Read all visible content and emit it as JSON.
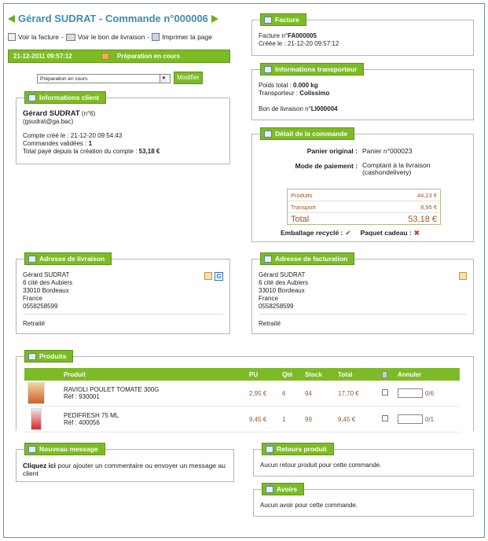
{
  "header": {
    "title": "Gérard SUDRAT - Commande n°000006",
    "links": [
      "Voir la facture",
      "Voir le bon de livraison",
      "Imprimer la page"
    ],
    "separator": "-"
  },
  "status": {
    "date": "21-12-2011 09:57:12",
    "label": "Préparation en cours",
    "select_value": "Préparation en cours",
    "button": "Modifier"
  },
  "client": {
    "title": "Informations client",
    "name": "Gérard SUDRAT",
    "num": "(n°6)",
    "email": "(gsudrat@ga.bac)",
    "created": "Compte créé le : 21-12-20   09:54:43",
    "validated_label": "Commandes validées :",
    "validated_value": "1",
    "total_label": "Total payé depuis la création du compte :",
    "total_value": "53,18 €"
  },
  "facture": {
    "title": "Facture",
    "num_label": "Facture n°",
    "num_value": "FA000005",
    "created": "Créée le : 21-12-20   09:57:12"
  },
  "transport": {
    "title": "Informations transporteur",
    "weight_label": "Poids total :",
    "weight_value": "0.000 kg",
    "carrier_label": "Transporteur :",
    "carrier_value": "Colissimo",
    "delivery_label": "Bon de livraison n°",
    "delivery_value": "LI000004"
  },
  "detail": {
    "title": "Détail de la commande",
    "cart_label": "Panier original :",
    "cart_value": "Panier n°000023",
    "payment_label": "Mode de paiement :",
    "payment_value_1": "Comptant à la livraison",
    "payment_value_2": "(cashondelivery)",
    "products_label": "Produits",
    "products_value": "44,23 €",
    "transport_label": "Transport",
    "transport_value": "8,95 €",
    "total_label": "Total",
    "total_value": "53,18 €",
    "recycled_label": "Emballage recyclé :",
    "gift_label": "Paquet cadeau :"
  },
  "delivery_address": {
    "title": "Adresse de livraison",
    "lines": [
      "Gérard SUDRAT",
      "6 cité des Aubiers",
      "33010 Bordeaux",
      "France",
      "0558258599"
    ],
    "note": "Retraité"
  },
  "billing_address": {
    "title": "Adresse de facturation",
    "lines": [
      "Gérard SUDRAT",
      "6 cité des Aubiers",
      "33010 Bordeaux",
      "France",
      "0558258599"
    ],
    "note": "Retraité"
  },
  "products": {
    "title": "Produits",
    "columns": {
      "product": "Produit",
      "pu": "PU",
      "qty": "Qté",
      "stock": "Stock",
      "total": "Total",
      "cancel": "Annuler"
    },
    "rows": [
      {
        "name": "RAVIOLI POULET TOMATE 300G",
        "ref": "Réf : 930001",
        "pu": "2,95 €",
        "qty": "6",
        "stock": "94",
        "total": "17,70 €",
        "max": "0/6"
      },
      {
        "name": "PEDIFRESH 75 ML",
        "ref": "Réf : 400056",
        "pu": "9,45 €",
        "qty": "1",
        "stock": "99",
        "total": "9,45 €",
        "max": "0/1"
      }
    ]
  },
  "message": {
    "title": "Nouveau message",
    "link": "Cliquez ici",
    "text": " pour ajouter un commentaire ou envoyer un message au client"
  },
  "returns": {
    "title": "Retours produit",
    "text": "Aucun retour produit pour cette commande."
  },
  "credits": {
    "title": "Avoirs",
    "text": "Aucun avoir pour cette commande."
  }
}
